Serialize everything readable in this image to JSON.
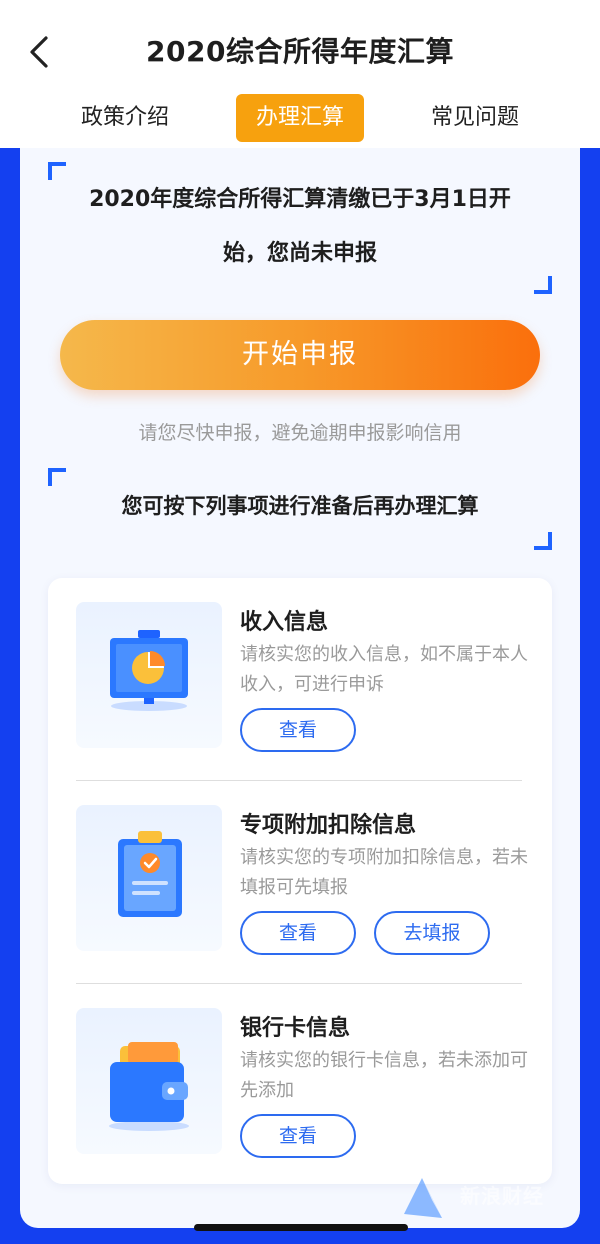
{
  "header": {
    "title": "2020综合所得年度汇算",
    "back_icon": "chevron-left-icon"
  },
  "tabs": [
    {
      "label": "政策介绍",
      "active": false
    },
    {
      "label": "办理汇算",
      "active": true
    },
    {
      "label": "常见问题",
      "active": false
    }
  ],
  "notice": {
    "line1": "2020年度综合所得汇算清缴已于3月1日开",
    "line2": "始，您尚未申报"
  },
  "start_button": {
    "label": "开始申报"
  },
  "hint": "请您尽快申报，避免逾期申报影响信用",
  "prep_title": "您可按下列事项进行准备后再办理汇算",
  "items": [
    {
      "title": "收入信息",
      "desc": "请核实您的收入信息，如不属于本人收入，可进行申诉",
      "icon": "presentation-chart-icon",
      "buttons": [
        "查看"
      ]
    },
    {
      "title": "专项附加扣除信息",
      "desc": "请核实您的专项附加扣除信息，若未填报可先填报",
      "icon": "clipboard-check-icon",
      "buttons": [
        "查看",
        "去填报"
      ]
    },
    {
      "title": "银行卡信息",
      "desc": "请核实您的银行卡信息，若未添加可先添加",
      "icon": "wallet-icon",
      "buttons": [
        "查看"
      ]
    }
  ],
  "colors": {
    "accent_orange": "#f7a10e",
    "frame_blue": "#1440f0",
    "link_blue": "#2d6bf0"
  },
  "watermark": {
    "text": "新浪财经"
  }
}
